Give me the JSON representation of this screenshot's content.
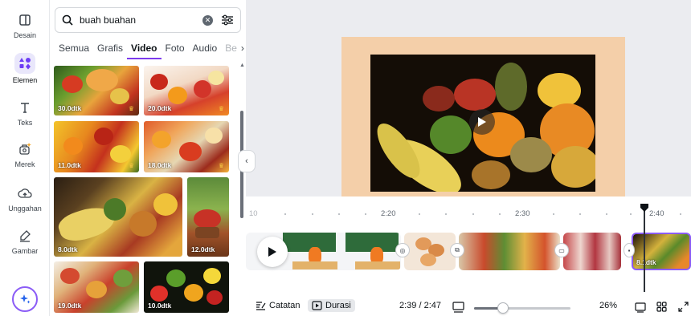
{
  "rail": {
    "items": [
      {
        "label": "Desain",
        "icon": "layout-icon"
      },
      {
        "label": "Elemen",
        "icon": "shapes-icon"
      },
      {
        "label": "Teks",
        "icon": "text-icon"
      },
      {
        "label": "Merek",
        "icon": "brand-icon"
      },
      {
        "label": "Unggahan",
        "icon": "upload-cloud-icon"
      },
      {
        "label": "Gambar",
        "icon": "draw-icon"
      }
    ],
    "magic_icon": "magic-sparkle-icon"
  },
  "panel": {
    "search": {
      "value": "buah buahan",
      "placeholder": "Cari elemen"
    },
    "tabs": [
      {
        "label": "Semua"
      },
      {
        "label": "Grafis"
      },
      {
        "label": "Video",
        "active": true
      },
      {
        "label": "Foto"
      },
      {
        "label": "Audio"
      },
      {
        "label": "Be"
      }
    ],
    "results": [
      {
        "duration": "30.0dtk",
        "premium": true
      },
      {
        "duration": "20.0dtk",
        "premium": true
      },
      {
        "duration": "11.0dtk",
        "premium": true
      },
      {
        "duration": "18.0dtk",
        "premium": true
      },
      {
        "duration": "8.0dtk",
        "premium": false
      },
      {
        "duration": "12.0dtk",
        "premium": false
      },
      {
        "duration": "19.0dtk",
        "premium": false
      },
      {
        "duration": "10.0dtk",
        "premium": false
      }
    ]
  },
  "timeline": {
    "ruler_labels": [
      "10",
      "2:20",
      "2:30",
      "2:40"
    ],
    "clip_label": "8.1dtk"
  },
  "bottombar": {
    "notes": "Catatan",
    "duration": "Durasi",
    "time": "2:39 / 2:47",
    "zoom": "26%",
    "zoom_level": 0.3
  },
  "colors": {
    "accent": "#7c3aed",
    "canvas_bg": "#f4cfa9",
    "workspace": "#ebecf0"
  }
}
